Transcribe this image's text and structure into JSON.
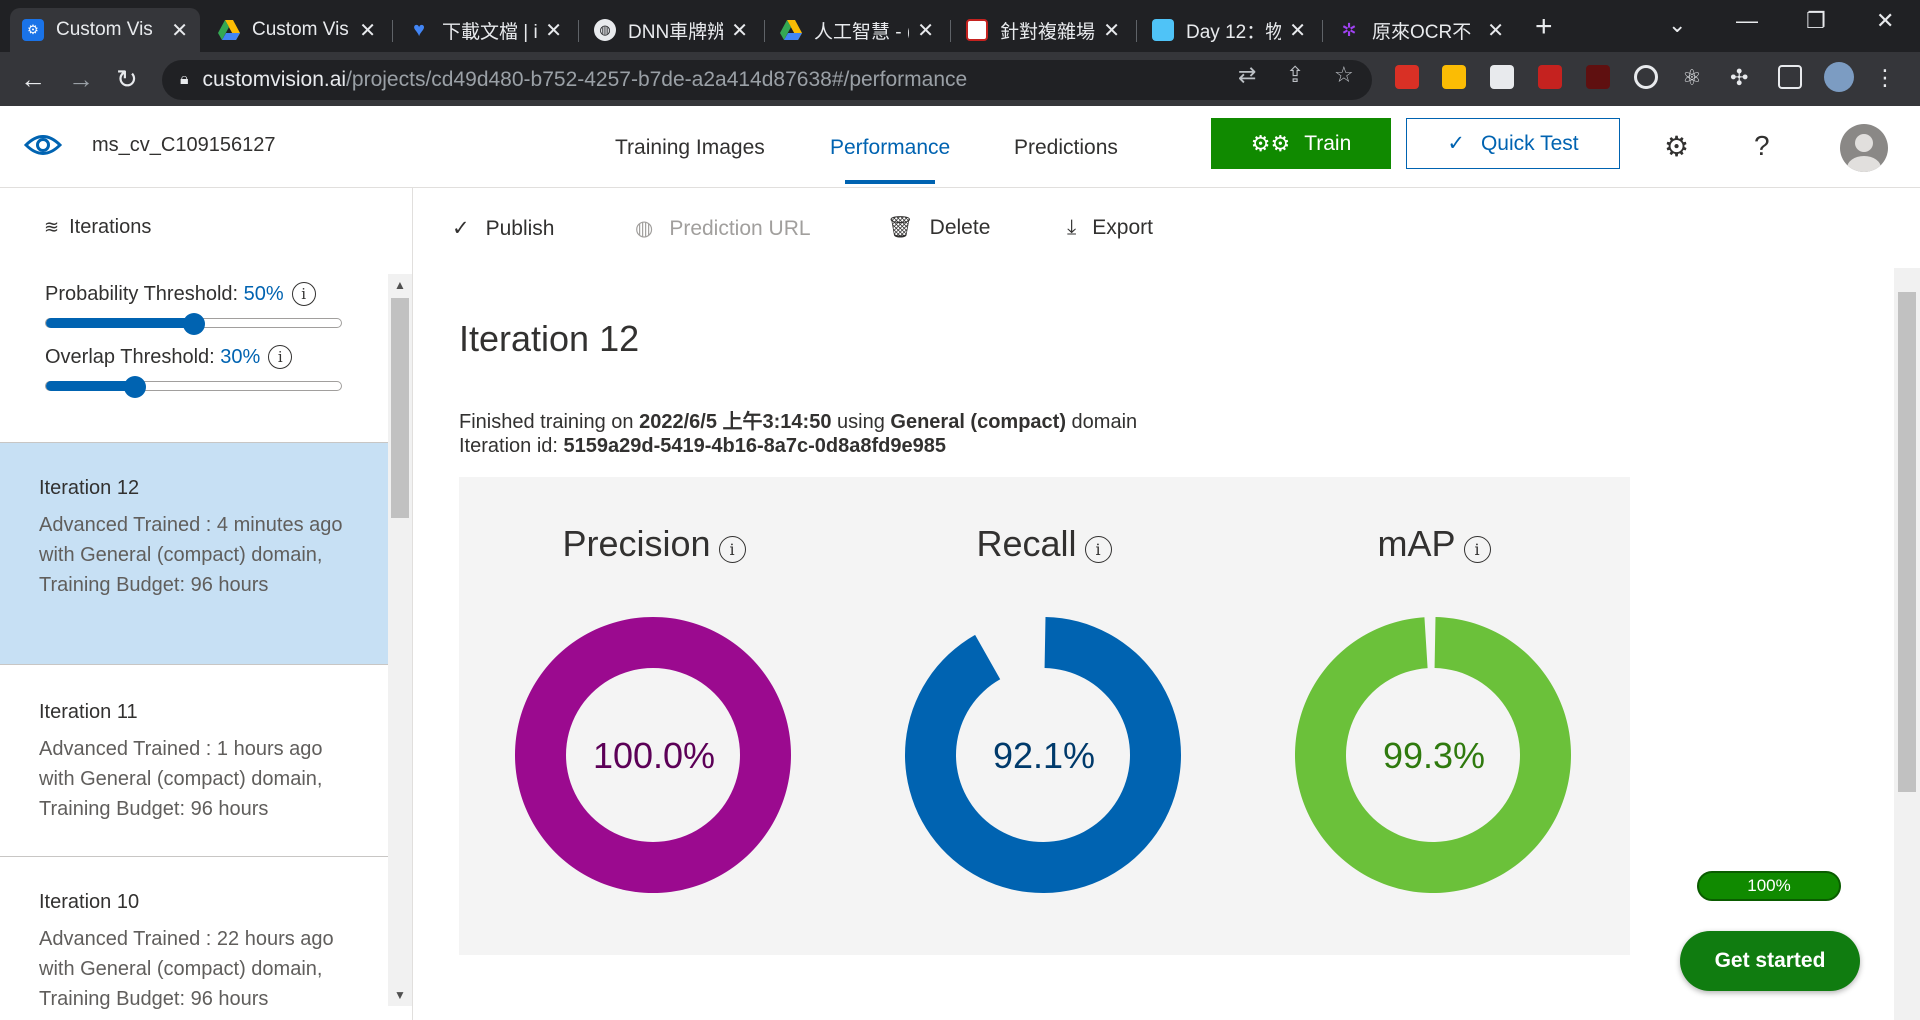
{
  "browser": {
    "tabs": [
      {
        "title": "Custom Vis",
        "active": true,
        "favicon_color": "#1a73e8",
        "favicon": "gear-icon"
      },
      {
        "title": "Custom Vis",
        "active": false,
        "favicon_color": "#34a853",
        "favicon": "drive-icon"
      },
      {
        "title": "下載文檔 | i",
        "active": false,
        "favicon_color": "#4285f4",
        "favicon": "heart-icon"
      },
      {
        "title": "DNN車牌辨",
        "active": false,
        "favicon_color": "#e8eaed",
        "favicon": "globe-icon"
      },
      {
        "title": "人工智慧 - (",
        "active": false,
        "favicon_color": "#fbbc04",
        "favicon": "drive-icon"
      },
      {
        "title": "針對複雜場",
        "active": false,
        "favicon_color": "#c5221f",
        "favicon": "doc-icon"
      },
      {
        "title": "Day 12：物",
        "active": false,
        "favicon_color": "#4fc3f7",
        "favicon": "ithome-icon"
      },
      {
        "title": "原來OCR不",
        "active": false,
        "favicon_color": "#a142f4",
        "favicon": "slack-icon"
      }
    ],
    "url_host": "customvision.ai",
    "url_path": "/projects/cd49d480-b752-4257-b7de-a2a414d87638#/performance"
  },
  "app": {
    "project_name": "ms_cv_C109156127",
    "nav": {
      "training_images": "Training Images",
      "performance": "Performance",
      "predictions": "Predictions"
    },
    "train_label": "Train",
    "quick_test_label": "Quick Test",
    "help_label": "?"
  },
  "sidebar": {
    "header": "Iterations",
    "probability_label": "Probability Threshold:",
    "probability_value": "50%",
    "probability_level": 0.5,
    "overlap_label": "Overlap Threshold:",
    "overlap_value": "30%",
    "overlap_level": 0.3,
    "iterations": [
      {
        "name": "Iteration 12",
        "desc": "Advanced Trained : 4 minutes ago with General (compact) domain, Training Budget: 96 hours",
        "selected": true
      },
      {
        "name": "Iteration 11",
        "desc": "Advanced Trained : 1 hours ago with General (compact) domain, Training Budget: 96 hours",
        "selected": false
      },
      {
        "name": "Iteration 10",
        "desc": "Advanced Trained : 22 hours ago with General (compact) domain, Training Budget: 96 hours",
        "selected": false
      }
    ]
  },
  "commands": {
    "publish": "Publish",
    "prediction_url": "Prediction URL",
    "delete": "Delete",
    "export": "Export"
  },
  "main": {
    "title": "Iteration 12",
    "finished_prefix": "Finished training on ",
    "finished_date": "2022/6/5 上午3:14:50",
    "finished_mid": " using ",
    "finished_domain": "General (compact)",
    "finished_suffix": " domain",
    "iter_id_label": "Iteration id: ",
    "iter_id": "5159a29d-5419-4b16-8a7c-0d8a8fd9e985",
    "metrics": [
      {
        "label": "Precision",
        "value_text": "100.0%",
        "value": 100.0,
        "color": "#9b0a8f",
        "text_color": "#5c0057"
      },
      {
        "label": "Recall",
        "value_text": "92.1%",
        "value": 92.1,
        "color": "#0063b1",
        "text_color": "#003a6b"
      },
      {
        "label": "mAP",
        "value_text": "99.3%",
        "value": 99.3,
        "color": "#6bc13a",
        "text_color": "#2f7a0e"
      }
    ]
  },
  "widget": {
    "progress_text": "100%",
    "get_started": "Get started"
  },
  "colors": {
    "accent": "#0063b1",
    "train_green": "#108a00",
    "selected_row": "#c7e0f4"
  }
}
